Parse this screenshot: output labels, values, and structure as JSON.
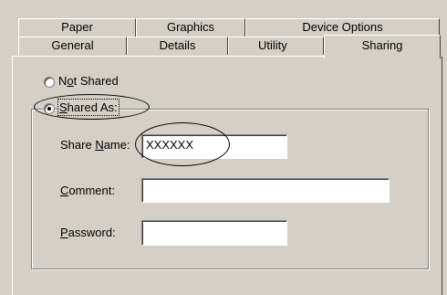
{
  "tabs_back": [
    {
      "label": "Paper"
    },
    {
      "label": "Graphics"
    },
    {
      "label": "Device Options"
    }
  ],
  "tabs_front": [
    {
      "label": "General"
    },
    {
      "label": "Details"
    },
    {
      "label": "Utility"
    },
    {
      "label": "Sharing"
    }
  ],
  "sharing": {
    "not_shared_pre": "N",
    "not_shared_u": "o",
    "not_shared_post": "t Shared",
    "shared_as_u": "S",
    "shared_as_post": "hared As:",
    "selected_option": "Shared As:"
  },
  "fields": {
    "share_name_pre": "Share ",
    "share_name_u": "N",
    "share_name_post": "ame:",
    "share_name_value": "XXXXXX",
    "comment_u": "C",
    "comment_post": "omment:",
    "comment_value": "",
    "password_u": "P",
    "password_post": "assword:",
    "password_value": ""
  }
}
